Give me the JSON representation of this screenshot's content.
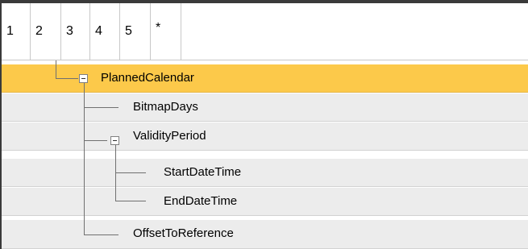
{
  "header": {
    "columns": [
      "1",
      "2",
      "3",
      "4",
      "5",
      "*"
    ]
  },
  "tree": {
    "rows": [
      {
        "label": "PlannedCalendar",
        "selected": true,
        "toggle": "collapse"
      },
      {
        "label": "BitmapDays"
      },
      {
        "label": "ValidityPeriod",
        "toggle": "collapse"
      },
      {
        "label": "StartDateTime"
      },
      {
        "label": "EndDateTime"
      },
      {
        "label": "OffsetToReference"
      }
    ]
  },
  "colors": {
    "selected_row": "#fcc94a",
    "row_background": "#ececec",
    "grid_line": "#c8c8c8"
  }
}
